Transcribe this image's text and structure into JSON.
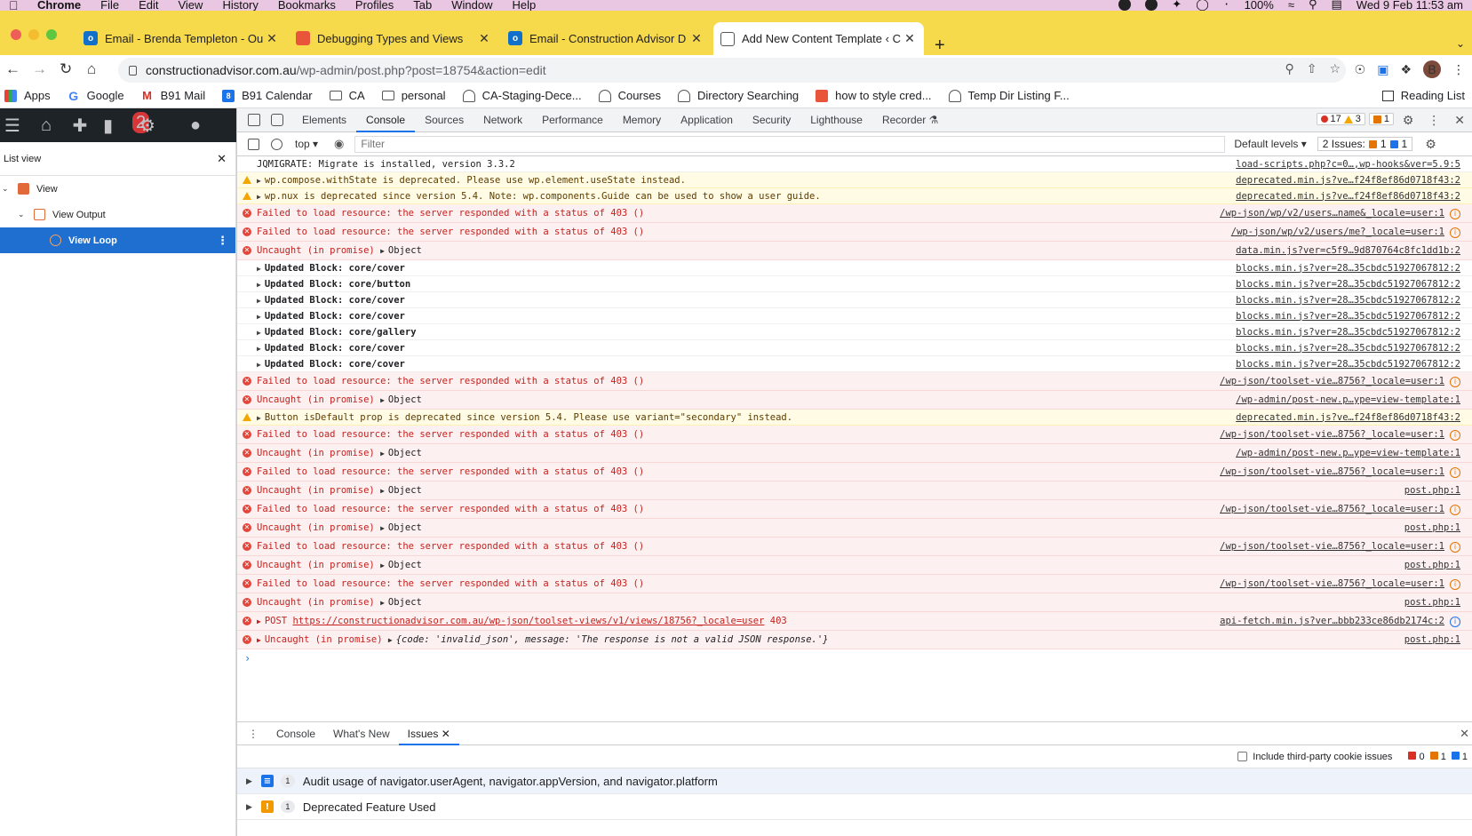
{
  "menubar": {
    "app": "Chrome",
    "items": [
      "File",
      "Edit",
      "View",
      "History",
      "Bookmarks",
      "Profiles",
      "Tab",
      "Window",
      "Help"
    ],
    "battery": "100%",
    "clock": "Wed 9 Feb  11:53 am"
  },
  "tabs": [
    {
      "title": "Email - Brenda Templeton - Ou",
      "icon": "outlook-icon"
    },
    {
      "title": "Debugging Types and Views",
      "icon": "debug-icon"
    },
    {
      "title": "Email - Construction Advisor D",
      "icon": "outlook-icon"
    },
    {
      "title": "Add New Content Template ‹ C",
      "icon": "bell-icon",
      "active": true
    }
  ],
  "address": {
    "domain": "constructionadvisor.com.au",
    "path": "/wp-admin/post.php?post=18754&action=edit"
  },
  "profile_initial": "B",
  "bookmarks": [
    "Apps",
    "Google",
    "B91 Mail",
    "B91 Calendar",
    "CA",
    "personal",
    "CA-Staging-Dece...",
    "Courses",
    "Directory Searching",
    "how to style cred...",
    "Temp Dir Listing F..."
  ],
  "reading_list": "Reading List",
  "wp": {
    "badge": "2",
    "list_view_title": "List view",
    "tree": [
      {
        "label": "View",
        "level": 0
      },
      {
        "label": "View Output",
        "level": 1
      },
      {
        "label": "View Loop",
        "level": 2,
        "selected": true
      }
    ]
  },
  "devtools": {
    "tabs": [
      "Elements",
      "Console",
      "Sources",
      "Network",
      "Performance",
      "Memory",
      "Application",
      "Security",
      "Lighthouse",
      "Recorder ⚗"
    ],
    "active_tab": "Console",
    "counts": {
      "errors": "17",
      "warnings": "3",
      "issues": "1"
    },
    "context": "top ▾",
    "filter_placeholder": "Filter",
    "default_levels": "Default levels ▾",
    "issues_label": "2 Issues:",
    "issues_orange": "1",
    "issues_blue": "1",
    "colors": {
      "error_bg": "#fdf0f0",
      "warn_bg": "#fffbe5",
      "accent": "#1a73e8"
    }
  },
  "console": [
    {
      "type": "log",
      "msg": "JQMIGRATE: Migrate is installed, version 3.3.2",
      "src": "load-scripts.php?c=0…,wp-hooks&ver=5.9:5"
    },
    {
      "type": "warn",
      "expand": true,
      "msg": "wp.compose.withState is deprecated. Please use wp.element.useState instead.",
      "src": "deprecated.min.js?ve…f24f8ef86d0718f43:2"
    },
    {
      "type": "warn",
      "expand": true,
      "msg": "wp.nux is deprecated since version 5.4. Note: wp.components.Guide can be used to show a user guide.",
      "src": "deprecated.min.js?ve…f24f8ef86d0718f43:2"
    },
    {
      "type": "err",
      "msg": "Failed to load resource: the server responded with a status of 403 ()",
      "src": "/wp-json/wp/v2/users…name&_locale=user:1",
      "info": true
    },
    {
      "type": "err",
      "msg": "Failed to load resource: the server responded with a status of 403 ()",
      "src": "/wp-json/wp/v2/users/me?_locale=user:1",
      "info": true
    },
    {
      "type": "err",
      "msg": "Uncaught (in promise) ",
      "obj": "Object",
      "src": "data.min.js?ver=c5f9…9d870764c8fc1dd1b:2"
    },
    {
      "type": "bold",
      "expand": true,
      "msg": "Updated Block: core/cover",
      "src": "blocks.min.js?ver=28…35cbdc51927067812:2"
    },
    {
      "type": "bold",
      "expand": true,
      "msg": "Updated Block: core/button",
      "src": "blocks.min.js?ver=28…35cbdc51927067812:2"
    },
    {
      "type": "bold",
      "expand": true,
      "msg": "Updated Block: core/cover",
      "src": "blocks.min.js?ver=28…35cbdc51927067812:2"
    },
    {
      "type": "bold",
      "expand": true,
      "msg": "Updated Block: core/cover",
      "src": "blocks.min.js?ver=28…35cbdc51927067812:2"
    },
    {
      "type": "bold",
      "expand": true,
      "msg": "Updated Block: core/gallery",
      "src": "blocks.min.js?ver=28…35cbdc51927067812:2"
    },
    {
      "type": "bold",
      "expand": true,
      "msg": "Updated Block: core/cover",
      "src": "blocks.min.js?ver=28…35cbdc51927067812:2"
    },
    {
      "type": "bold",
      "expand": true,
      "msg": "Updated Block: core/cover",
      "src": "blocks.min.js?ver=28…35cbdc51927067812:2"
    },
    {
      "type": "err",
      "msg": "Failed to load resource: the server responded with a status of 403 ()",
      "src": "/wp-json/toolset-vie…8756?_locale=user:1",
      "info": true
    },
    {
      "type": "err",
      "msg": "Uncaught (in promise) ",
      "obj": "Object",
      "src": "/wp-admin/post-new.p…ype=view-template:1"
    },
    {
      "type": "warn",
      "expand": true,
      "msg": "Button isDefault prop is deprecated since version 5.4. Please use variant=\"secondary\" instead.",
      "src": "deprecated.min.js?ve…f24f8ef86d0718f43:2"
    },
    {
      "type": "err",
      "msg": "Failed to load resource: the server responded with a status of 403 ()",
      "src": "/wp-json/toolset-vie…8756?_locale=user:1",
      "info": true
    },
    {
      "type": "err",
      "msg": "Uncaught (in promise) ",
      "obj": "Object",
      "src": "/wp-admin/post-new.p…ype=view-template:1"
    },
    {
      "type": "err",
      "msg": "Failed to load resource: the server responded with a status of 403 ()",
      "src": "/wp-json/toolset-vie…8756?_locale=user:1",
      "info": true
    },
    {
      "type": "err",
      "msg": "Uncaught (in promise) ",
      "obj": "Object",
      "src": "post.php:1"
    },
    {
      "type": "err",
      "msg": "Failed to load resource: the server responded with a status of 403 ()",
      "src": "/wp-json/toolset-vie…8756?_locale=user:1",
      "info": true
    },
    {
      "type": "err",
      "msg": "Uncaught (in promise) ",
      "obj": "Object",
      "src": "post.php:1"
    },
    {
      "type": "err",
      "msg": "Failed to load resource: the server responded with a status of 403 ()",
      "src": "/wp-json/toolset-vie…8756?_locale=user:1",
      "info": true
    },
    {
      "type": "err",
      "msg": "Uncaught (in promise) ",
      "obj": "Object",
      "src": "post.php:1"
    },
    {
      "type": "err",
      "msg": "Failed to load resource: the server responded with a status of 403 ()",
      "src": "/wp-json/toolset-vie…8756?_locale=user:1",
      "info": true
    },
    {
      "type": "err",
      "msg": "Uncaught (in promise) ",
      "obj": "Object",
      "src": "post.php:1"
    },
    {
      "type": "err",
      "expand": true,
      "msg": "POST ",
      "link": "https://constructionadvisor.com.au/wp-json/toolset-views/v1/views/18756?_locale=user",
      "tail": " 403",
      "src": "api-fetch.min.js?ver…bbb233ce86db2174c:2",
      "info_blue": true
    },
    {
      "type": "err",
      "expand": true,
      "msg": "Uncaught (in promise) ",
      "json": "{code: 'invalid_json', message: 'The response is not a valid JSON response.'}",
      "src": "post.php:1"
    }
  ],
  "drawer": {
    "tabs": [
      "Console",
      "What's New",
      "Issues"
    ],
    "active": "Issues",
    "third_party": "Include third-party cookie issues",
    "counts": {
      "red": "0",
      "orange": "1",
      "blue": "1"
    },
    "issues": [
      {
        "count": "1",
        "kind": "b",
        "title": "Audit usage of navigator.userAgent, navigator.appVersion, and navigator.platform"
      },
      {
        "count": "1",
        "kind": "o",
        "title": "Deprecated Feature Used"
      }
    ]
  }
}
